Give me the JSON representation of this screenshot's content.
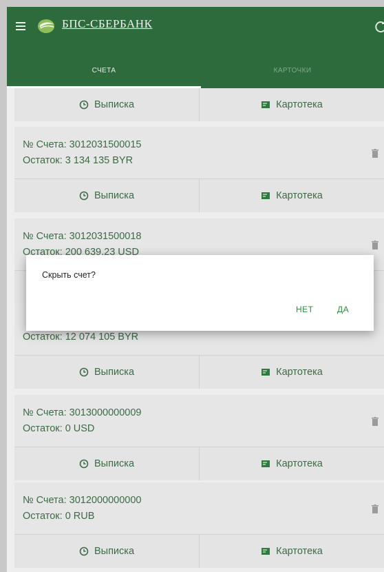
{
  "header": {
    "brand": "БПС-СБЕРБАНК",
    "menu_icon": "hamburger-menu-icon",
    "refresh_icon": "refresh-icon",
    "color": "#2e6b3c"
  },
  "tabs": [
    {
      "label": "СЧЕТА",
      "active": true
    },
    {
      "label": "КАРТОЧКИ"
    }
  ],
  "action_labels": {
    "statement": "Выписка",
    "card_index": "Картотека"
  },
  "accounts": [
    {
      "number": "№ Счета: 3012031500015",
      "balance": "Остаток: 3 134 135 BYR"
    },
    {
      "number": "№ Счета: 3012031500018",
      "balance": "Остаток: 200 639.23 USD"
    },
    {
      "number": "",
      "balance": "Остаток: 12 074 105 BYR"
    },
    {
      "number": "№ Счета: 3013000000009",
      "balance": "Остаток: 0 USD"
    },
    {
      "number": "№ Счета: 3012000000000",
      "balance": "Остаток: 0 RUB"
    }
  ],
  "dialog": {
    "title": "Скрыть счет?",
    "no_label": "НЕТ",
    "yes_label": "ДА"
  }
}
